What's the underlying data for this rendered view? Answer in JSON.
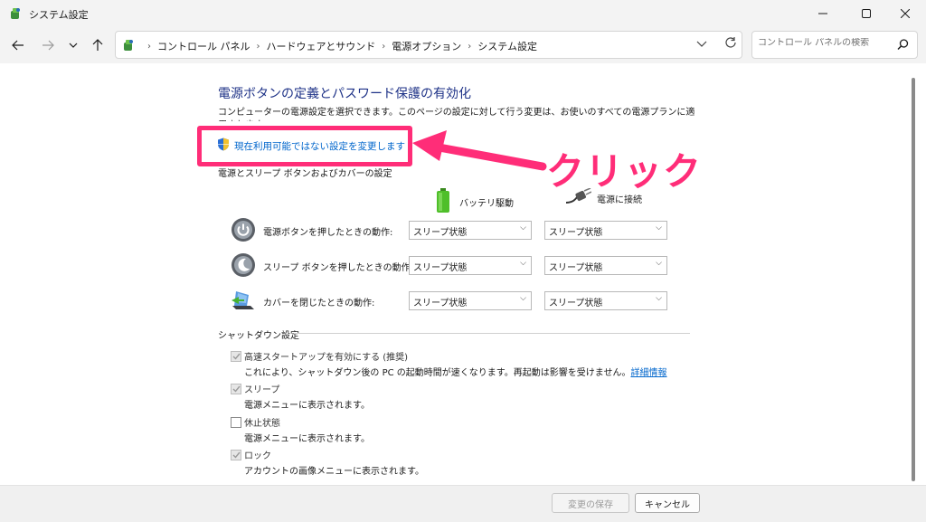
{
  "window": {
    "title": "システム設定",
    "icon": "control-panel-icon"
  },
  "address_bar": {
    "crumbs": [
      "コントロール パネル",
      "ハードウェアとサウンド",
      "電源オプション",
      "システム設定"
    ]
  },
  "search": {
    "placeholder": "コントロール パネルの検索"
  },
  "page": {
    "title": "電源ボタンの定義とパスワード保護の有効化",
    "description": "コンピューターの電源設定を選択できます。このページの設定に対して行う変更は、お使いのすべての電源プランに適用されます。",
    "change_link": "現在利用可能ではない設定を変更します"
  },
  "annotation": {
    "label": "クリック",
    "color": "#ff2d78"
  },
  "power_section": {
    "title": "電源とスリープ ボタンおよびカバーの設定",
    "columns": {
      "battery": "バッテリ駆動",
      "plugged": "電源に接続"
    },
    "rows": [
      {
        "label": "電源ボタンを押したときの動作:",
        "battery": "スリープ状態",
        "plugged": "スリープ状態",
        "icon": "power-button-icon"
      },
      {
        "label": "スリープ ボタンを押したときの動作:",
        "battery": "スリープ状態",
        "plugged": "スリープ状態",
        "icon": "sleep-button-icon"
      },
      {
        "label": "カバーを閉じたときの動作:",
        "battery": "スリープ状態",
        "plugged": "スリープ状態",
        "icon": "laptop-lid-icon"
      }
    ]
  },
  "shutdown_section": {
    "title": "シャットダウン設定",
    "items": [
      {
        "label": "高速スタートアップを有効にする (推奨)",
        "desc": "これにより、シャットダウン後の PC の起動時間が速くなります。再起動は影響を受けません。",
        "link": "詳細情報",
        "checked": true
      },
      {
        "label": "スリープ",
        "desc": "電源メニューに表示されます。",
        "checked": true
      },
      {
        "label": "休止状態",
        "desc": "電源メニューに表示されます。",
        "checked": false
      },
      {
        "label": "ロック",
        "desc": "アカウントの画像メニューに表示されます。",
        "checked": true
      }
    ]
  },
  "footer": {
    "save_label": "変更の保存",
    "cancel_label": "キャンセル"
  }
}
